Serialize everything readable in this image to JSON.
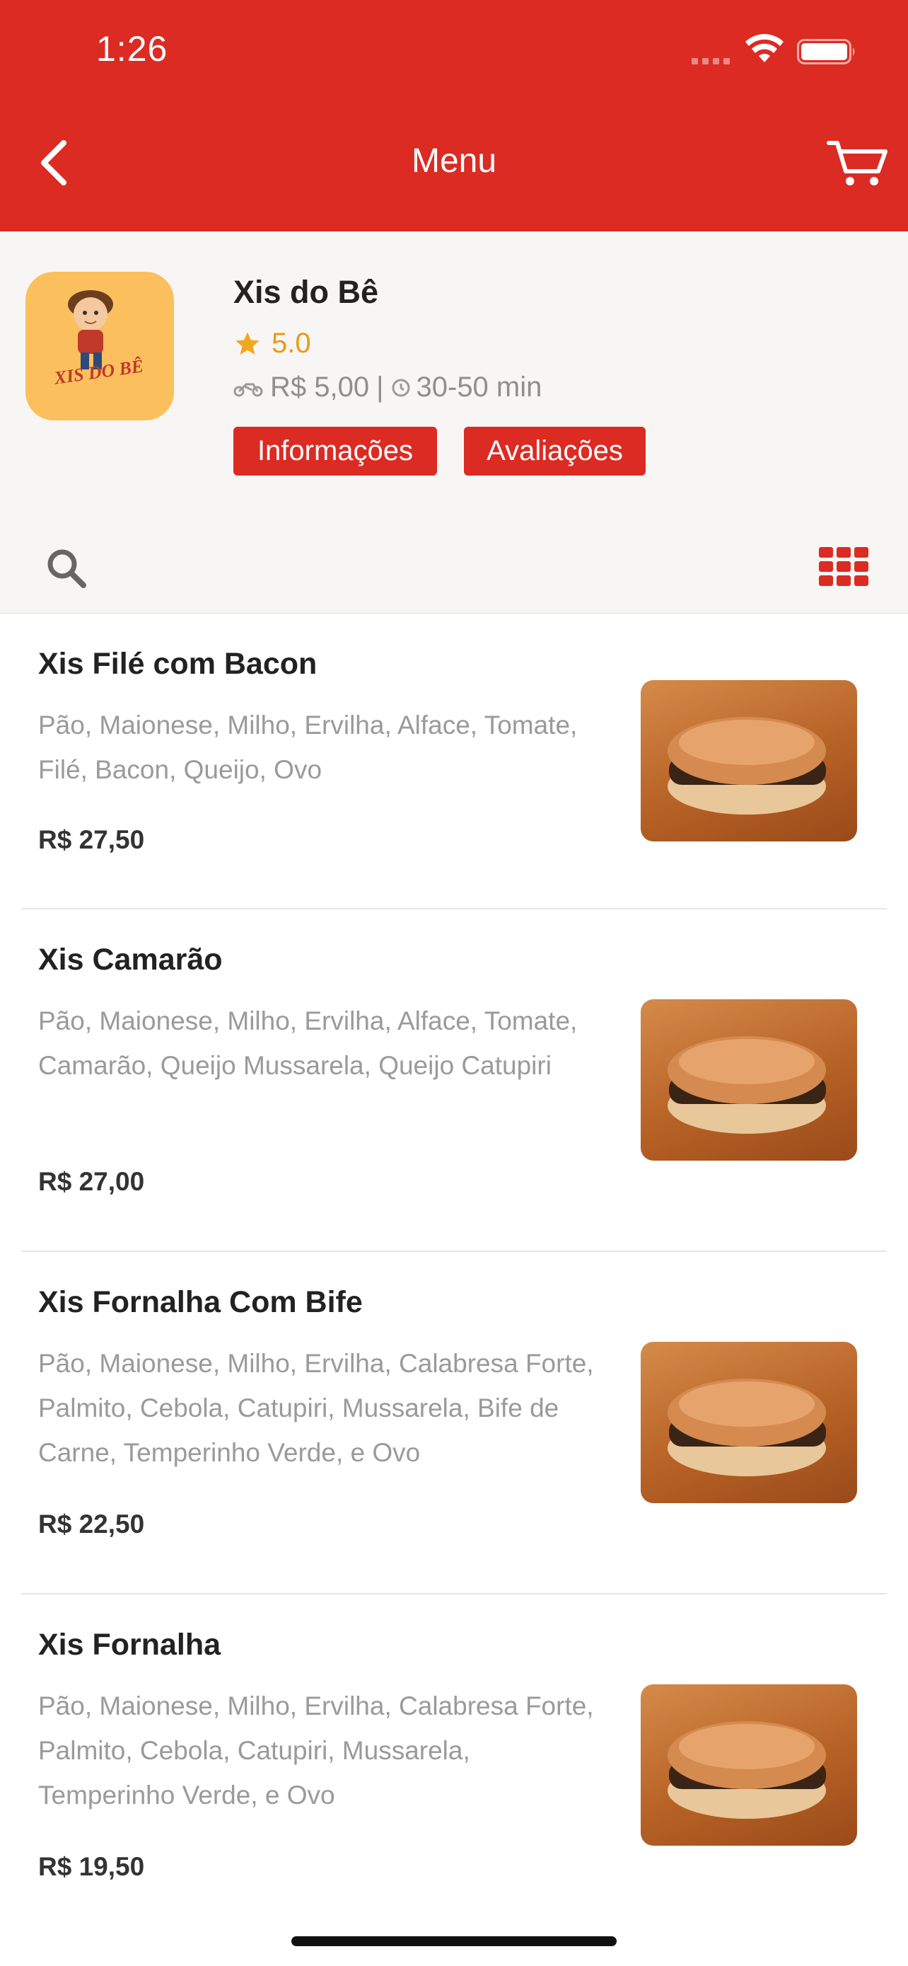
{
  "status_bar": {
    "time": "1:26"
  },
  "nav": {
    "title": "Menu"
  },
  "store": {
    "name": "Xis do Bê",
    "logo_text": "XIS DO BÊ",
    "rating": "5.0",
    "delivery_fee": "R$ 5,00",
    "separator": "|",
    "delivery_time": "30-50 min",
    "tabs": [
      "Informações",
      "Avaliações"
    ]
  },
  "menu": [
    {
      "title": "Xis Filé com Bacon",
      "description": "Pão, Maionese, Milho, Ervilha, Alface, Tomate, Filé, Bacon, Queijo, Ovo",
      "price": "R$ 27,50"
    },
    {
      "title": "Xis Camarão",
      "description": "Pão, Maionese, Milho, Ervilha, Alface, Tomate, Camarão, Queijo Mussarela, Queijo Catupiri",
      "price": "R$ 27,00"
    },
    {
      "title": "Xis Fornalha Com Bife",
      "description": "Pão, Maionese, Milho, Ervilha, Calabresa Forte, Palmito, Cebola, Catupiri, Mussarela, Bife de Carne, Temperinho Verde, e Ovo",
      "price": "R$ 22,50"
    },
    {
      "title": "Xis Fornalha",
      "description": "Pão, Maionese, Milho, Ervilha, Calabresa Forte, Palmito, Cebola, Catupiri, Mussarela, Temperinho Verde, e Ovo",
      "price": "R$ 19,50"
    }
  ],
  "icons": {
    "back": "chevron-left-icon",
    "cart": "cart-icon",
    "star": "star-icon",
    "moto": "motorcycle-icon",
    "clock": "clock-icon",
    "search": "search-icon",
    "grid": "grid-icon"
  },
  "colors": {
    "brand": "#db2b23",
    "rating": "#f0a81e",
    "logo_bg": "#fbc05d"
  }
}
